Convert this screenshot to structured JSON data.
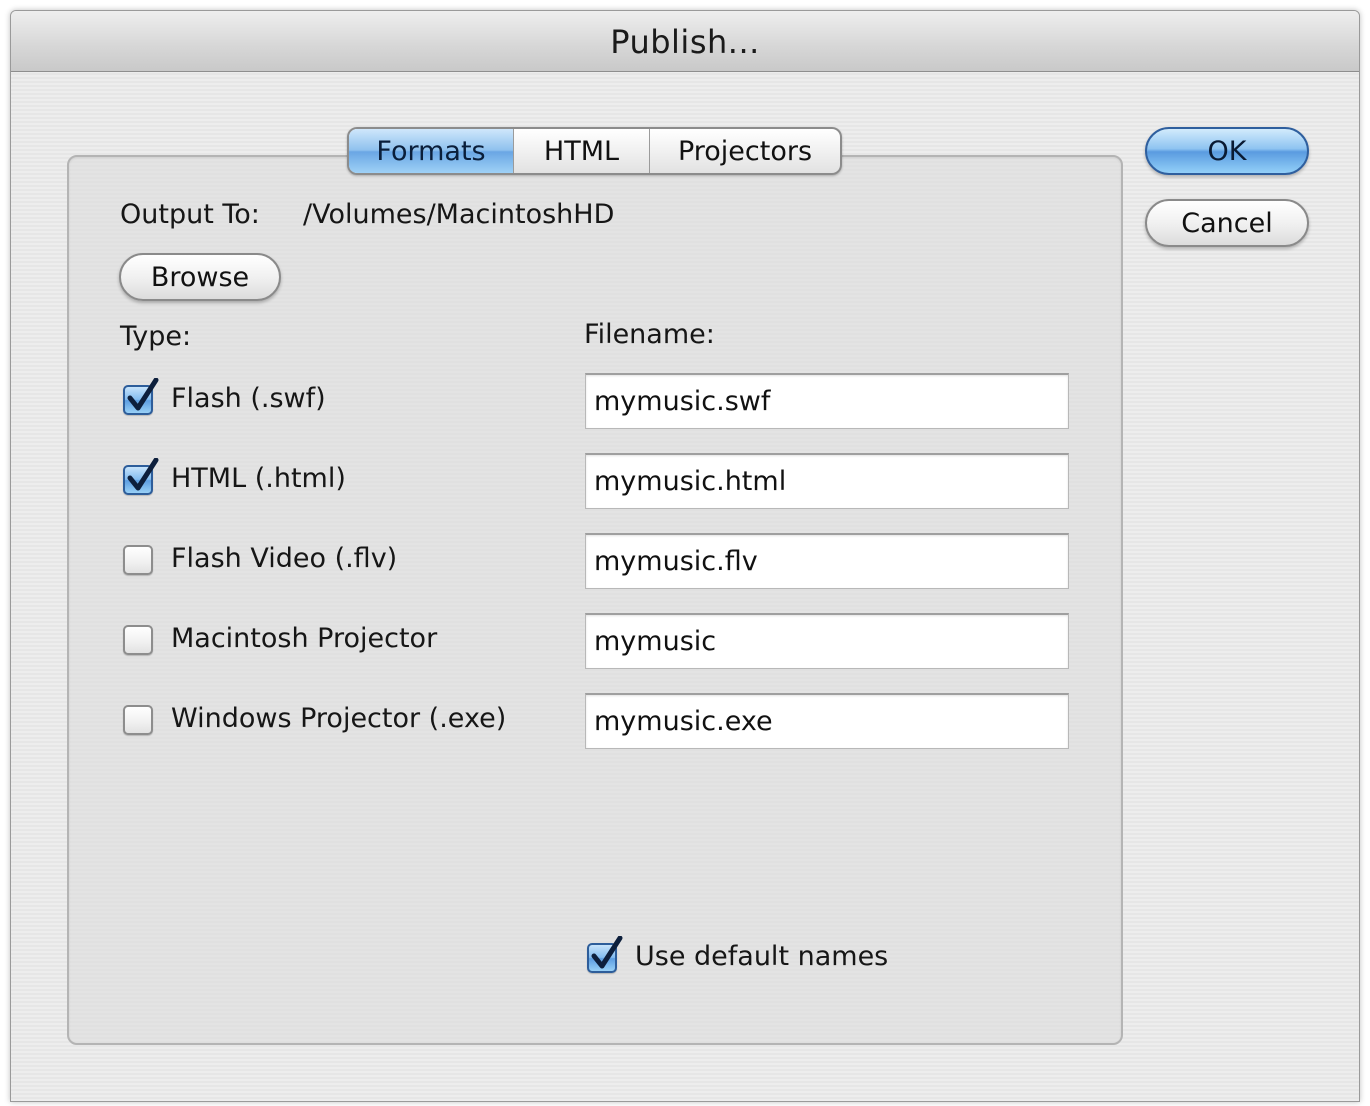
{
  "window": {
    "title": "Publish..."
  },
  "tabs": [
    {
      "label": "Formats",
      "selected": true
    },
    {
      "label": "HTML",
      "selected": false
    },
    {
      "label": "Projectors",
      "selected": false
    }
  ],
  "buttons": {
    "ok": "OK",
    "cancel": "Cancel",
    "browse": "Browse"
  },
  "output": {
    "label": "Output To:",
    "path": "/Volumes/MacintoshHD"
  },
  "headers": {
    "type": "Type:",
    "filename": "Filename:"
  },
  "formats": [
    {
      "label": "Flash (.swf)",
      "checked": true,
      "filename": "mymusic.swf"
    },
    {
      "label": "HTML (.html)",
      "checked": true,
      "filename": "mymusic.html"
    },
    {
      "label": "Flash Video (.flv)",
      "checked": false,
      "filename": "mymusic.flv"
    },
    {
      "label": "Macintosh Projector",
      "checked": false,
      "filename": "mymusic"
    },
    {
      "label": "Windows Projector (.exe)",
      "checked": false,
      "filename": "mymusic.exe"
    }
  ],
  "default_names": {
    "label": "Use default names",
    "checked": true
  },
  "colors": {
    "accent": "#6aa6e4",
    "dialog_bg": "#ececec",
    "tab_selected": "#8fc1ee"
  }
}
